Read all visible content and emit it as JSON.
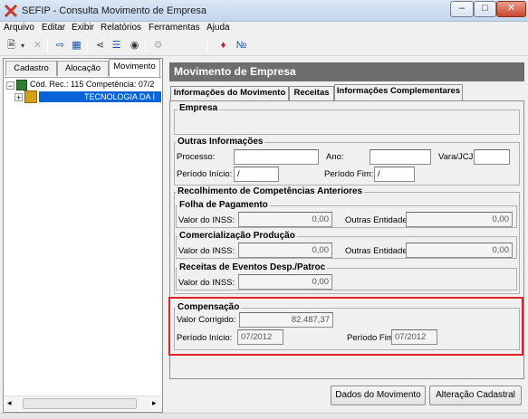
{
  "window": {
    "title": "SEFIP - Consulta Movimento de Empresa"
  },
  "menu": [
    "Arquivo",
    "Editar",
    "Exibir",
    "Relatórios",
    "Ferramentas",
    "Ajuda"
  ],
  "left_tabs": [
    "Cadastro",
    "Alocação",
    "Movimento"
  ],
  "tree": {
    "root_label": "Cód. Rec.: 115 Competência: 07/2",
    "child_label": "TECNOLOGIA DA I"
  },
  "panel": {
    "title": "Movimento de Empresa",
    "tabs": [
      "Informações do Movimento",
      "Receitas",
      "Informações Complementares"
    ]
  },
  "empresa": {
    "title": "Empresa"
  },
  "outras": {
    "title": "Outras Informações",
    "processo_label": "Processo:",
    "ano_label": "Ano:",
    "vara_label": "Vara/JCJ:",
    "inicio_label": "Período Início:",
    "inicio_value": "/",
    "fim_label": "Período Fim:",
    "fim_value": "/"
  },
  "recolhimento": {
    "title": "Recolhimento de Competências Anteriores",
    "folha": {
      "title": "Folha de Pagamento",
      "inss_label": "Valor do INSS:",
      "inss_value": "0,00",
      "outras_label": "Outras Entidades:",
      "outras_value": "0,00"
    },
    "comerc": {
      "title": "Comercialização Produção",
      "inss_label": "Valor do INSS:",
      "inss_value": "0,00",
      "outras_label": "Outras Entidades:",
      "outras_value": "0,00"
    },
    "eventos": {
      "title": "Receitas de Eventos Desp./Patroc",
      "inss_label": "Valor do INSS:",
      "inss_value": "0,00"
    }
  },
  "compensacao": {
    "title": "Compensação",
    "valor_label": "Valor Corrigido:",
    "valor_value": "82.487,37",
    "inicio_label": "Período Início:",
    "inicio_value": "07/2012",
    "fim_label": "Período Fim:",
    "fim_value": "07/2012"
  },
  "buttons": {
    "dados": "Dados do Movimento",
    "alteracao": "Alteração Cadastral"
  },
  "colors": {
    "highlight": "#e02424",
    "tree_selection": "#0a64d6",
    "header": "#6e6e6e"
  }
}
